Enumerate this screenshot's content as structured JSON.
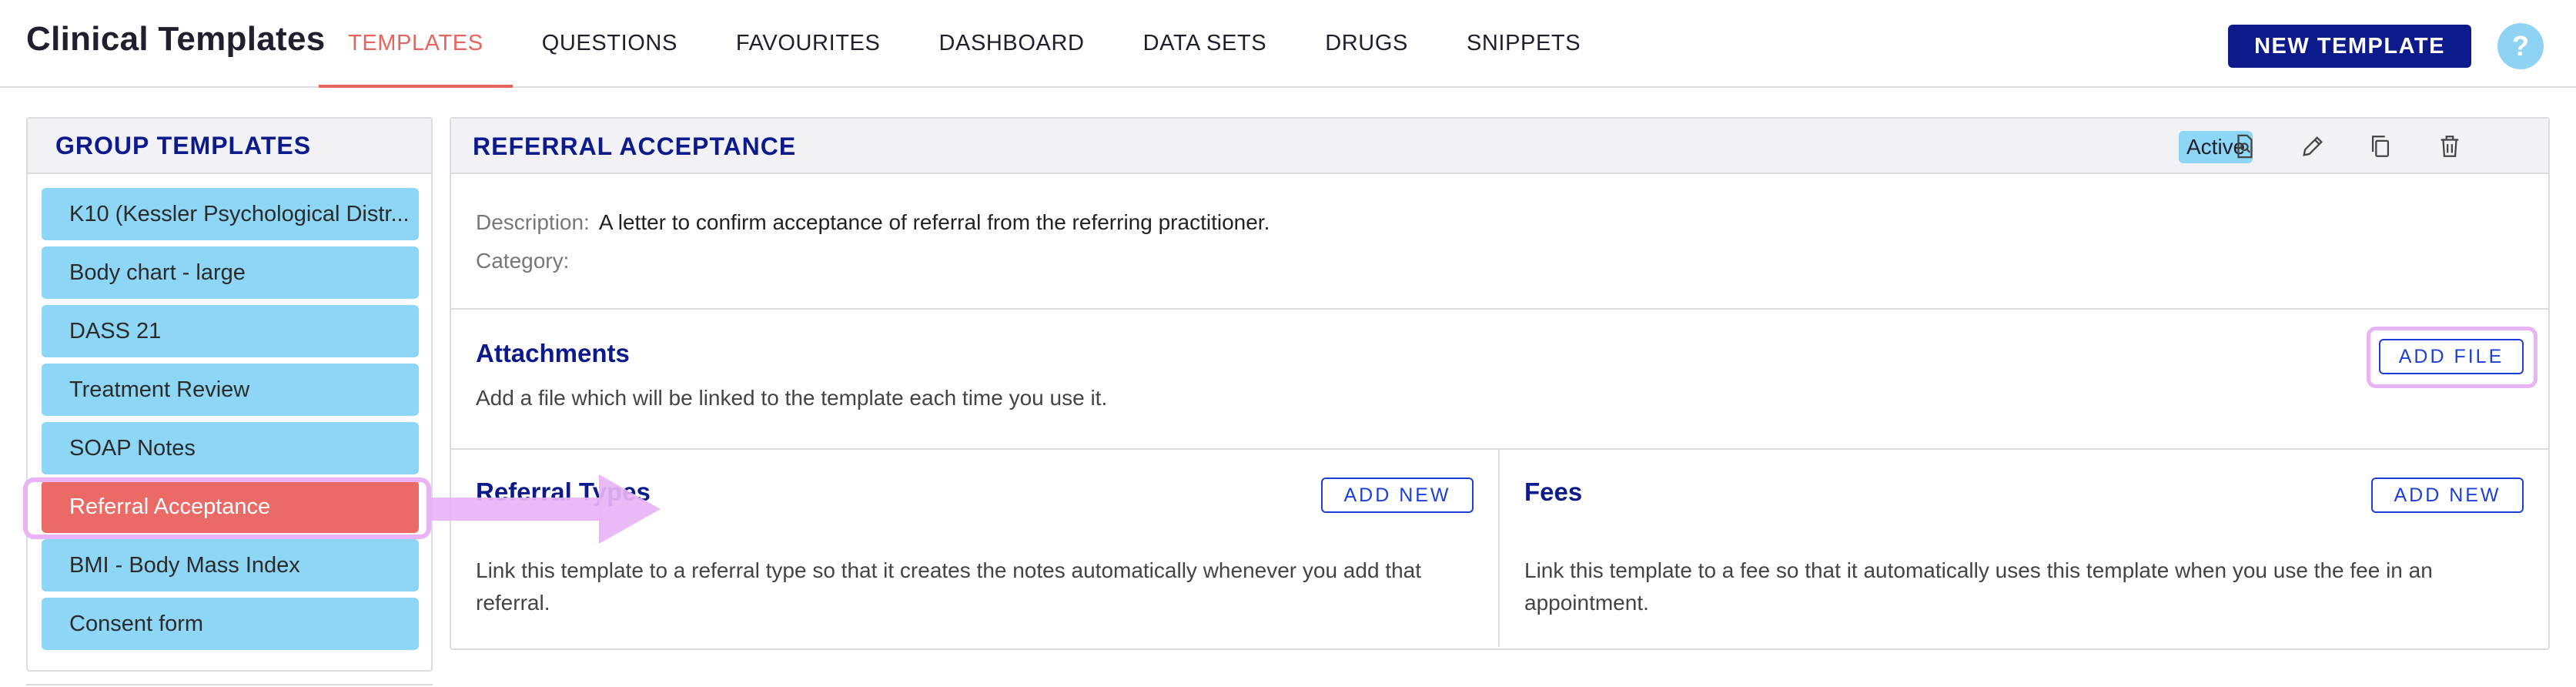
{
  "header": {
    "app_title": "Clinical Templates",
    "tabs": [
      {
        "label": "TEMPLATES",
        "active": true
      },
      {
        "label": "QUESTIONS",
        "active": false
      },
      {
        "label": "FAVOURITES",
        "active": false
      },
      {
        "label": "DASHBOARD",
        "active": false
      },
      {
        "label": "DATA SETS",
        "active": false
      },
      {
        "label": "DRUGS",
        "active": false
      },
      {
        "label": "SNIPPETS",
        "active": false
      }
    ],
    "new_template_label": "NEW TEMPLATE",
    "help_label": "?"
  },
  "sidebar": {
    "title": "GROUP TEMPLATES",
    "items": [
      {
        "label": "K10 (Kessler Psychological Distr..."
      },
      {
        "label": "Body chart - large"
      },
      {
        "label": "DASS 21"
      },
      {
        "label": "Treatment Review"
      },
      {
        "label": "SOAP Notes"
      },
      {
        "label": "Referral Acceptance",
        "selected": true
      },
      {
        "label": "BMI - Body Mass Index"
      },
      {
        "label": "Consent form"
      }
    ]
  },
  "detail": {
    "title": "REFERRAL ACCEPTANCE",
    "status": "Active",
    "actions": [
      "preview-icon",
      "edit-icon",
      "copy-icon",
      "delete-icon"
    ],
    "description_label": "Description:",
    "description_value": "A letter to confirm acceptance of referral from the referring practitioner.",
    "category_label": "Category:",
    "category_value": "",
    "attachments": {
      "title": "Attachments",
      "text": "Add a file which will be linked to the template each time you use it.",
      "button": "ADD FILE"
    },
    "referral_types": {
      "title": "Referral Types",
      "text": "Link this template to a referral type so that it creates the notes automatically whenever you add that referral.",
      "button": "ADD NEW"
    },
    "fees": {
      "title": "Fees",
      "text": "Link this template to a fee so that it automatically uses this template when you use the fee in an appointment.",
      "button": "ADD NEW"
    }
  },
  "colors": {
    "brand": "#0d1a8c",
    "active_tab": "#e8645f",
    "list_item": "#8ed6f5",
    "selected_item": "#ec6a66",
    "annotation": "#e8b4f5"
  }
}
